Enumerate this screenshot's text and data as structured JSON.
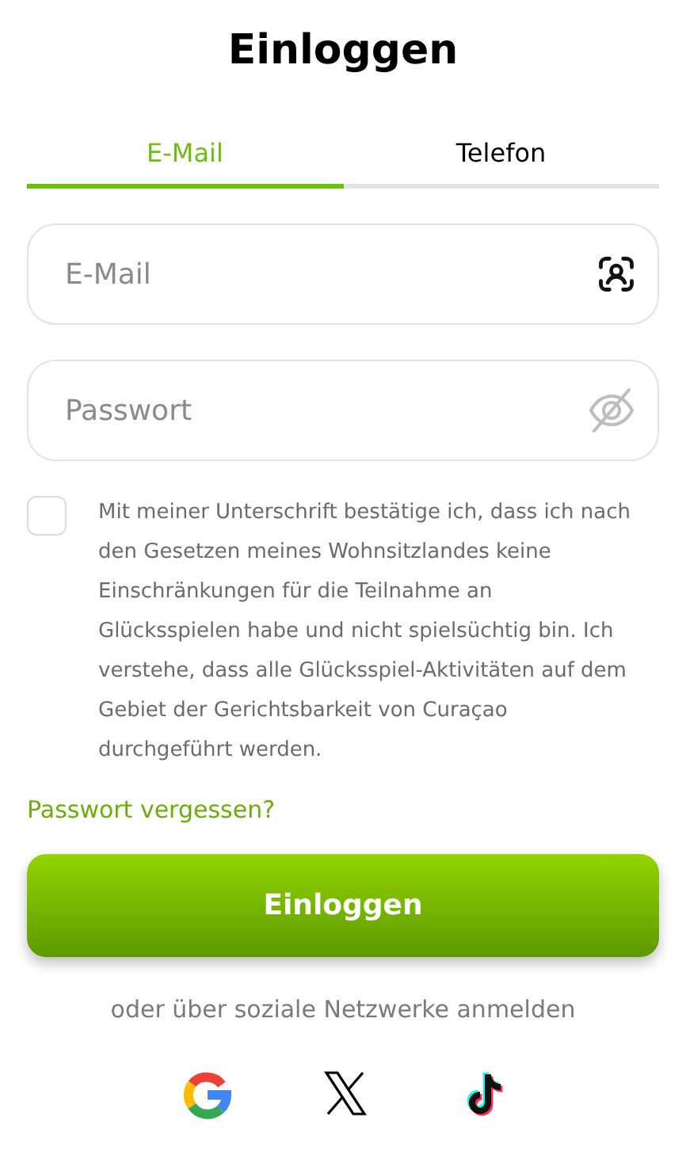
{
  "title": "Einloggen",
  "tabs": [
    {
      "label": "E-Mail",
      "selected": true
    },
    {
      "label": "Telefon",
      "selected": false
    }
  ],
  "fields": [
    {
      "kind": "email",
      "placeholder": "E-Mail"
    },
    {
      "kind": "password",
      "placeholder": "Passwort"
    }
  ],
  "consent": {
    "checked": false,
    "text": "Mit meiner Unterschrift bestätige ich, dass ich nach den Gesetzen meines Wohnsitzlandes keine Einschränkungen für die Teilnahme an Glücksspielen habe und nicht spielsüchtig bin. Ich verstehe, dass alle Glücksspiel-Aktivitäten auf dem Gebiet der Gerichtsbarkeit von Curaçao durchgeführt werden."
  },
  "forgot_link": "Passwort vergessen?",
  "submit_button": "Einloggen",
  "social_caption": "oder über soziale Netzwerke anmelden",
  "social": [
    {
      "kind": "google"
    },
    {
      "kind": "x"
    },
    {
      "kind": "tiktok"
    }
  ]
}
